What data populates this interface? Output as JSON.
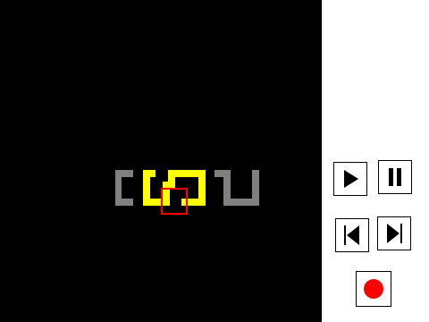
{
  "colors": {
    "background": "#000000",
    "panel": "#ffffff",
    "wall_active": "#ffff00",
    "wall_inactive": "#808080",
    "cursor": "#ff0000",
    "record": "#ff0000"
  },
  "pieces": [
    {
      "id": "piece-1",
      "state": "inactive",
      "shape": "left-bracket"
    },
    {
      "id": "piece-2",
      "state": "active",
      "shape": "ring-open-top"
    },
    {
      "id": "piece-3",
      "state": "active",
      "shape": "ring-open-top"
    },
    {
      "id": "piece-4",
      "state": "inactive",
      "shape": "hook"
    },
    {
      "id": "piece-5",
      "state": "inactive",
      "shape": "u-shape"
    }
  ],
  "controls": {
    "play": {
      "icon": "play-icon"
    },
    "pause": {
      "icon": "pause-icon"
    },
    "prev": {
      "icon": "step-back-icon"
    },
    "next": {
      "icon": "step-forward-icon"
    },
    "record": {
      "icon": "record-icon"
    }
  }
}
